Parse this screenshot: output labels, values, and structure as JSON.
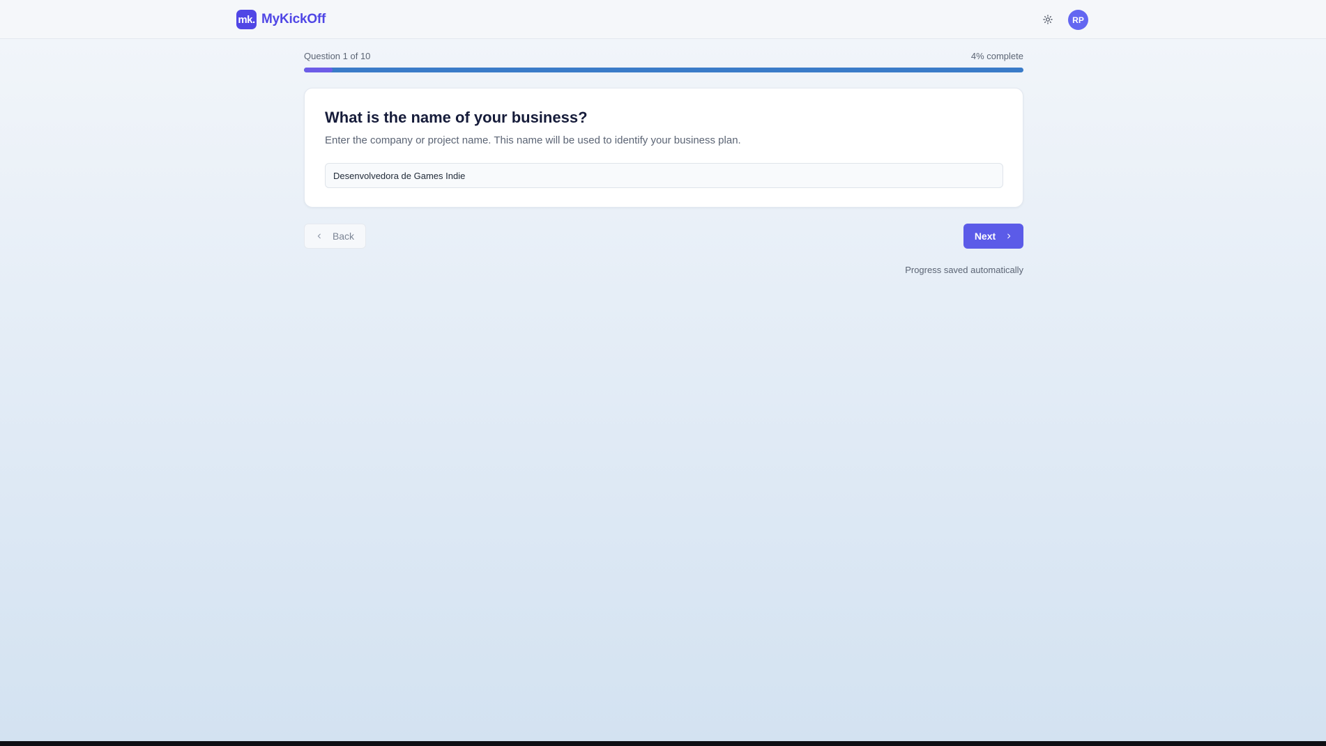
{
  "header": {
    "logo_text": "mk.",
    "brand_name": "MyKickOff",
    "theme_toggle_icon": "sun-icon",
    "avatar_initials": "RP"
  },
  "progress": {
    "question_label": "Question 1 of 10",
    "complete_label": "4% complete",
    "percent": 4
  },
  "question": {
    "title": "What is the name of your business?",
    "hint": "Enter the company or project name. This name will be used to identify your business plan.",
    "answer_value": "Desenvolvedora de Games Indie"
  },
  "navigation": {
    "back_label": "Back",
    "back_icon": "chevron-left-icon",
    "next_label": "Next",
    "next_icon": "chevron-right-icon"
  },
  "footer_note": "Progress saved automatically",
  "colors": {
    "brand": "#4f46e5",
    "primary_button": "#5b5be8",
    "progress_track": "#3a7bc8",
    "progress_fill": "#6d5ce7",
    "avatar": "#6366f1"
  }
}
